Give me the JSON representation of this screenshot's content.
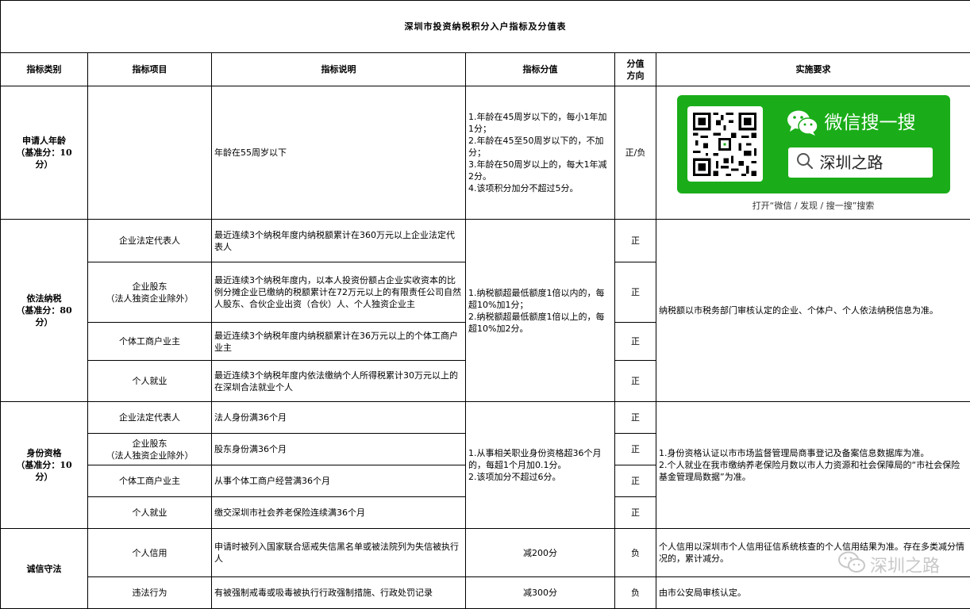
{
  "title": "深圳市投资纳税积分入户指标及分值表",
  "headers": {
    "category": "指标类别",
    "item": "指标项目",
    "description": "指标说明",
    "score": "指标分值",
    "direction_line1": "分值",
    "direction_line2": "方向",
    "requirements": "实施要求"
  },
  "age": {
    "category_line1": "申请人年龄",
    "category_line2": "（基准分：10",
    "category_line3": "分）",
    "description": "年龄在55周岁以下",
    "score_lines": [
      "1.年龄在45周岁以下的，每小1年加1分；",
      "2.年龄在45至50周岁以下的，不加分；",
      "3.年龄在50周岁以上的，每大1年减2分。",
      "4.该项积分加分不超过5分。"
    ],
    "direction": "正/负"
  },
  "wechat": {
    "title": "微信搜一搜",
    "search_text": "深圳之路",
    "caption": "打开“微信 / 发现 / 搜一搜”搜索",
    "accent": "#1aad19"
  },
  "tax": {
    "category_line1": "依法纳税",
    "category_line2": "（基准分：80",
    "category_line3": "分）",
    "rows": [
      {
        "item_line1": "企业法定代表人",
        "item_line2": "",
        "description": "最近连续3个纳税年度内纳税额累计在360万元以上企业法定代表人",
        "direction": "正"
      },
      {
        "item_line1": "企业股东",
        "item_line2": "（法人独资企业除外）",
        "description": "最近连续3个纳税年度内，以本人投资份额占企业实收资本的比例分摊企业已缴纳的税额累计在72万元以上的有限责任公司自然人股东、合伙企业出资（合伙）人、个人独资企业主",
        "direction": "正"
      },
      {
        "item_line1": "个体工商户业主",
        "item_line2": "",
        "description": "最近连续3个纳税年度内纳税额累计在36万元以上的个体工商户业主",
        "direction": "正"
      },
      {
        "item_line1": "个人就业",
        "item_line2": "",
        "description": "最近连续3个纳税年度内依法缴纳个人所得税累计30万元以上的在深圳合法就业个人",
        "direction": "正"
      }
    ],
    "score_lines": [
      "1.纳税额超最低额度1倍以内的，每超10%加1分；",
      "2.纳税额超最低额度1倍以上的，每超10%加2分。"
    ],
    "requirement": "纳税额以市税务部门审核认定的企业、个体户、个人依法纳税信息为准。"
  },
  "qualification": {
    "category_line1": "身份资格",
    "category_line2": "（基准分：10",
    "category_line3": "分）",
    "rows": [
      {
        "item_line1": "企业法定代表人",
        "item_line2": "",
        "description": "法人身份满36个月",
        "direction": "正"
      },
      {
        "item_line1": "企业股东",
        "item_line2": "（法人独资企业除外）",
        "description": "股东身份满36个月",
        "direction": "正"
      },
      {
        "item_line1": "个体工商户业主",
        "item_line2": "",
        "description": "从事个体工商户经营满36个月",
        "direction": "正"
      },
      {
        "item_line1": "个人就业",
        "item_line2": "",
        "description": "缴交深圳市社会养老保险连续满36个月",
        "direction": "正"
      }
    ],
    "score_lines": [
      "1.从事相关职业身份资格超36个月的，每超1个月加0.1分。",
      "2.该项加分不超过6分。"
    ],
    "requirement_lines": [
      "1.身份资格认证以市市场监督管理局商事登记及备案信息数据库为准。",
      "2.个人就业在我市缴纳养老保险月数以市人力资源和社会保障局的“市社会保险基金管理局数据”为准。"
    ]
  },
  "integrity": {
    "category": "诚信守法",
    "rows": [
      {
        "item": "个人信用",
        "description": "申请时被列入国家联合惩戒失信黑名单或被法院列为失信被执行人",
        "score": "减200分",
        "direction": "负",
        "requirement": "个人信用以深圳市个人信用征信系统核查的个人信用结果为准。存在多类减分情况的，累计减分。"
      },
      {
        "item": "违法行为",
        "description": "有被强制戒毒或吸毒被执行行政强制措施、行政处罚记录",
        "score": "减300分",
        "direction": "负",
        "requirement": "由市公安局审核认定。"
      }
    ]
  },
  "watermark": "深圳之路"
}
